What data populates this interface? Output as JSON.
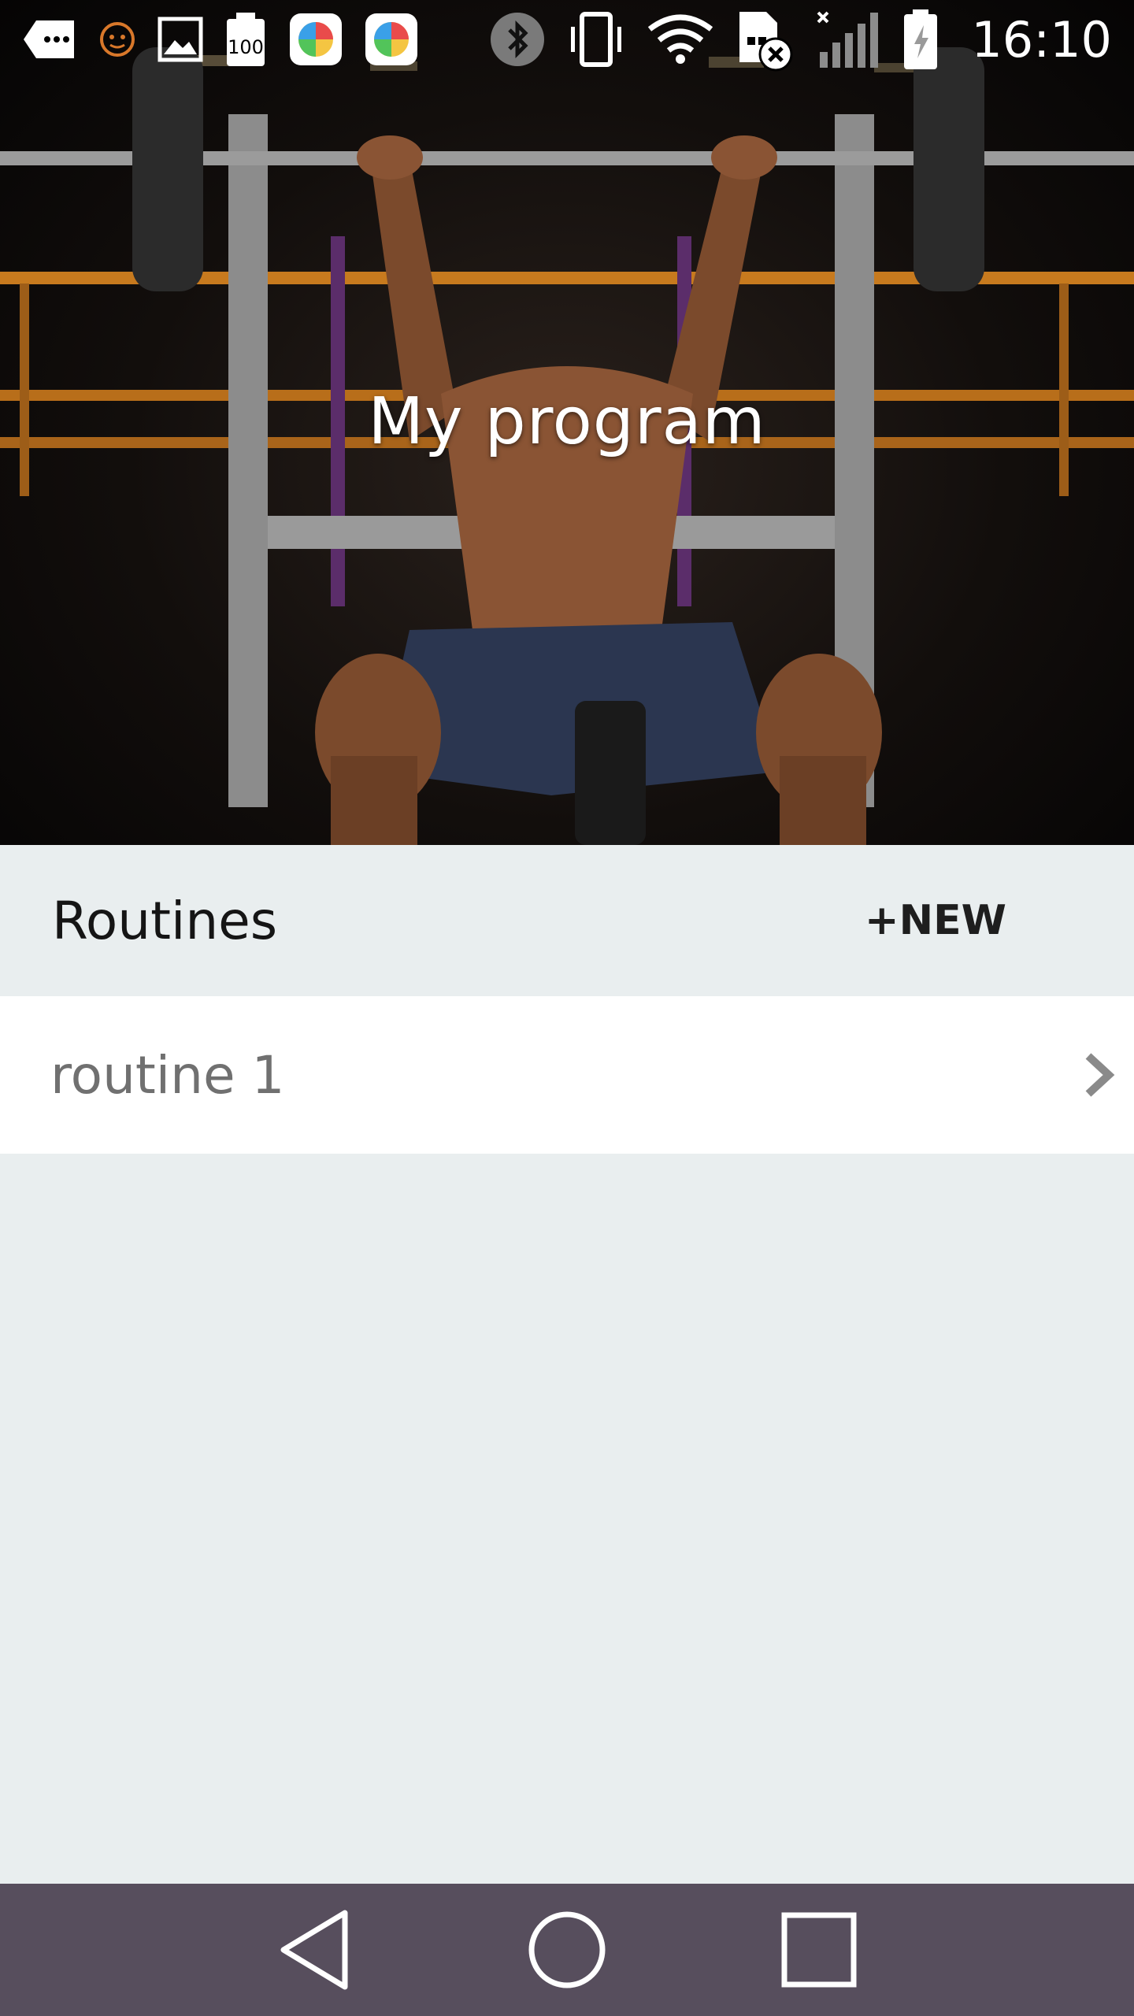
{
  "status_bar": {
    "time": "16:10",
    "icons": [
      "more-icon",
      "smiley-icon",
      "image-icon",
      "memory-100-icon",
      "app-colorful-icon",
      "app-colorful-icon",
      "bluetooth-icon",
      "vibrate-icon",
      "wifi-icon",
      "no-sim-icon",
      "signal-icon",
      "battery-charging-icon"
    ],
    "memory_label": "100"
  },
  "hero": {
    "title": "My program",
    "image": "man-bench-pressing-barbell-photo"
  },
  "routines_section": {
    "title": "Routines",
    "new_button_label": "+NEW"
  },
  "routines": [
    {
      "label": "routine 1"
    }
  ],
  "nav_bar": {
    "buttons": [
      "back-icon",
      "home-icon",
      "recents-icon"
    ]
  },
  "colors": {
    "background": "#e9eeef",
    "list_item_bg": "#ffffff",
    "nav_bar": "#574e5d",
    "list_text": "#707070"
  }
}
